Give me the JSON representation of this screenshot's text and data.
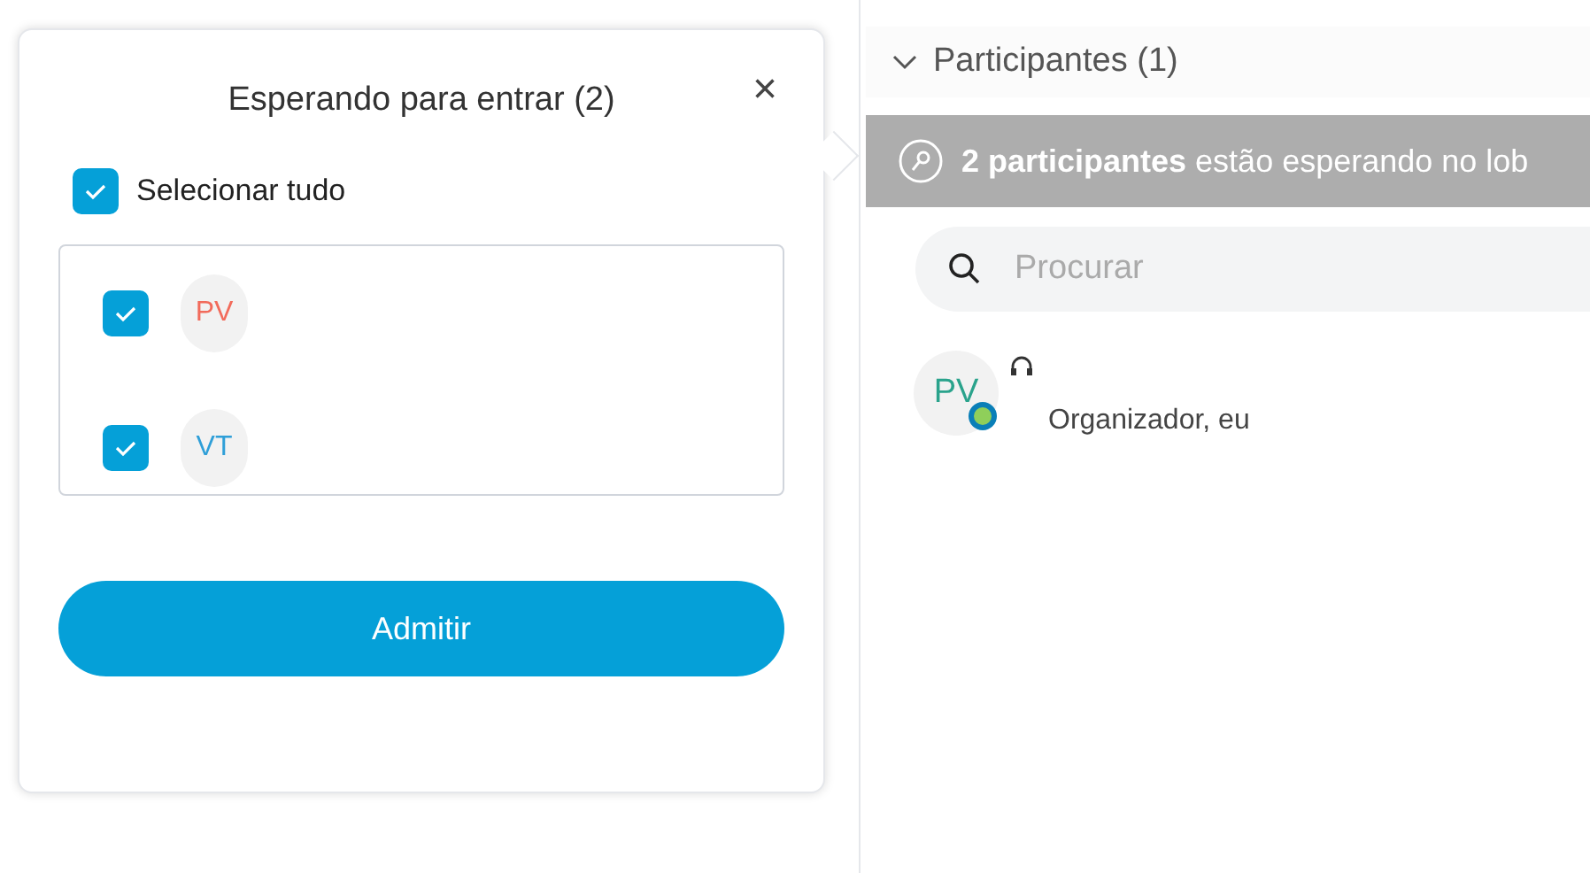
{
  "lobby_popup": {
    "title": "Esperando para entrar (2)",
    "close": "×",
    "select_all": {
      "label": "Selecionar tudo",
      "checked": true
    },
    "waiting": [
      {
        "initials": "PV",
        "color": "#f26b5b",
        "checked": true
      },
      {
        "initials": "VT",
        "color": "#2f9fd8",
        "checked": true
      }
    ],
    "admit_button": "Admitir"
  },
  "participants_panel": {
    "header": "Participantes (1)",
    "expanded": true,
    "lobby_banner": "**2 participantes** estão esperando no lob",
    "search": {
      "placeholder": "Procurar"
    },
    "participants": [
      {
        "initials": "PV",
        "color": "#2aa38c",
        "role": "Organizador, eu"
      }
    ]
  }
}
